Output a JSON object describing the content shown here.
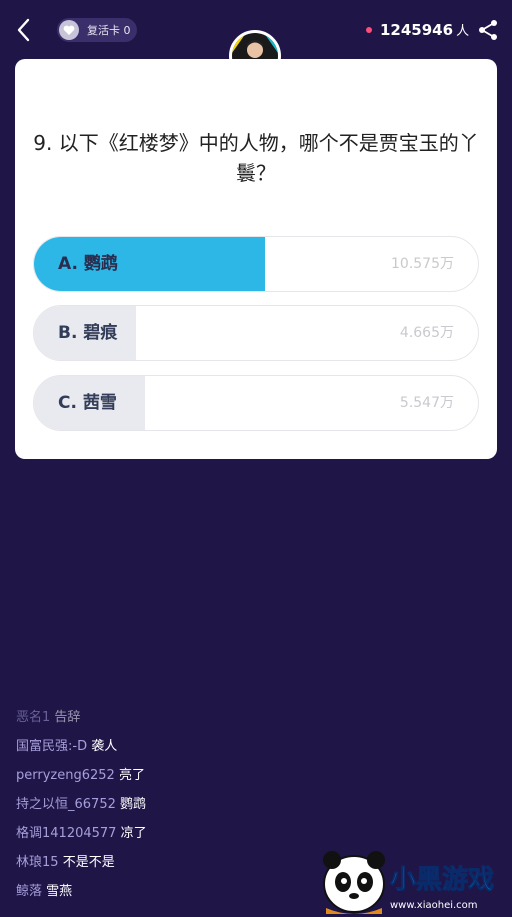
{
  "header": {
    "revive_card_label": "复活卡 0",
    "viewer_count": "1245946",
    "viewer_unit": "人"
  },
  "question": {
    "text": "9. 以下《红楼梦》中的人物，哪个不是贾宝玉的丫鬟？"
  },
  "options": [
    {
      "label": "A. 鹦鹉",
      "count": "10.575万",
      "share": 0.52,
      "selected": true
    },
    {
      "label": "B. 碧痕",
      "count": "4.665万",
      "share": 0.23,
      "selected": false
    },
    {
      "label": "C. 茜雪",
      "count": "5.547万",
      "share": 0.25,
      "selected": false
    }
  ],
  "chat": [
    {
      "user": "恶名1",
      "msg": "告辞"
    },
    {
      "user": "国富民强:-D",
      "msg": "袭人"
    },
    {
      "user": "perryzeng6252",
      "msg": "亮了"
    },
    {
      "user": "持之以恒_66752",
      "msg": "鹦鹉"
    },
    {
      "user": "格调141204577",
      "msg": "凉了"
    },
    {
      "user": "林琅15",
      "msg": "不是不是"
    },
    {
      "user": "鲸落",
      "msg": "雪燕"
    }
  ],
  "watermark": {
    "logo_text": "小黑游戏",
    "url": "www.xiaohei.com"
  },
  "colors": {
    "background": "#1f1547",
    "selected_fill": "#2cb7e6",
    "option_fill": "#e8eaef",
    "user_name": "#a79fdc"
  }
}
